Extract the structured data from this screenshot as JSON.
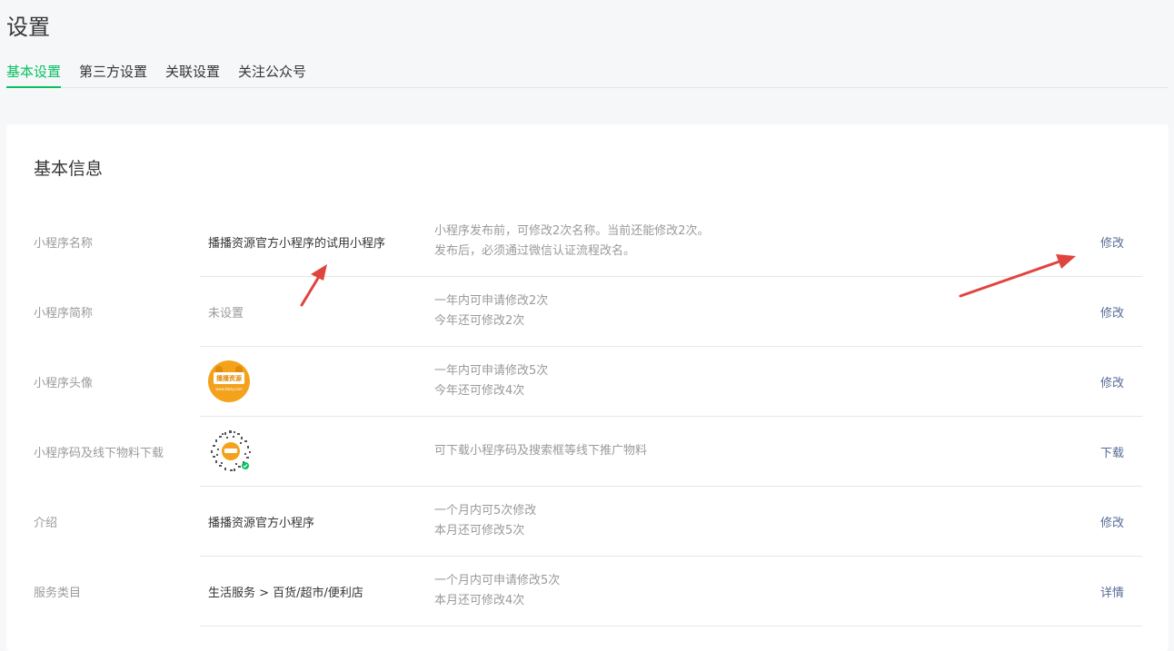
{
  "page": {
    "title": "设置"
  },
  "tabs": [
    {
      "label": "基本设置",
      "active": true
    },
    {
      "label": "第三方设置",
      "active": false
    },
    {
      "label": "关联设置",
      "active": false
    },
    {
      "label": "关注公众号",
      "active": false
    }
  ],
  "card": {
    "title": "基本信息"
  },
  "rows": [
    {
      "label": "小程序名称",
      "value": "播播资源官方小程序的试用小程序",
      "desc1": "小程序发布前，可修改2次名称。当前还能修改2次。",
      "desc2": "发布后，必须通过微信认证流程改名。",
      "action": "修改"
    },
    {
      "label": "小程序简称",
      "value": "未设置",
      "desc1": "一年内可申请修改2次",
      "desc2": "今年还可修改2次",
      "action": "修改"
    },
    {
      "label": "小程序头像",
      "avatar_text": "播播资源",
      "avatar_small": "www.bbzy.com",
      "desc1": "一年内可申请修改5次",
      "desc2": "今年还可修改4次",
      "action": "修改"
    },
    {
      "label": "小程序码及线下物料下载",
      "desc1": "可下载小程序码及搜索框等线下推广物料",
      "action": "下载"
    },
    {
      "label": "介绍",
      "value": "播播资源官方小程序",
      "desc1": "一个月内可5次修改",
      "desc2": "本月还可修改5次",
      "action": "修改"
    },
    {
      "label": "服务类目",
      "value": "生活服务 > 百货/超市/便利店",
      "desc1": "一个月内可申请修改5次",
      "desc2": "本月还可修改4次",
      "action": "详情"
    }
  ],
  "colors": {
    "accent": "#07c160",
    "link": "#576b95",
    "annotation_arrow": "#e0443e"
  },
  "icons": {
    "avatar": "mini-program-avatar-icon",
    "qr": "mini-program-code-icon"
  }
}
